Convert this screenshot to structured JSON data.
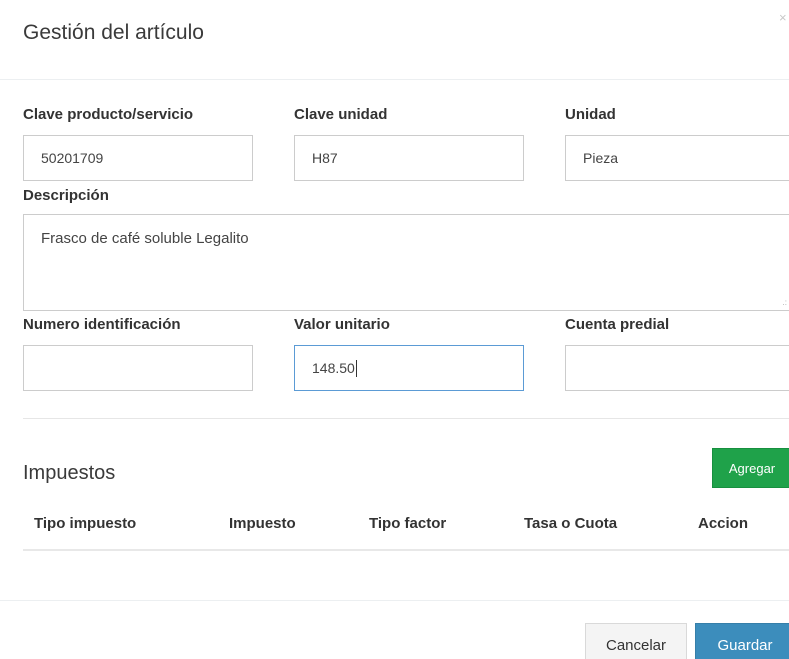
{
  "modal": {
    "title": "Gestión del artículo",
    "close_label": "×"
  },
  "form": {
    "clave_producto": {
      "label": "Clave producto/servicio",
      "value": "50201709"
    },
    "clave_unidad": {
      "label": "Clave unidad",
      "value": "H87"
    },
    "unidad": {
      "label": "Unidad",
      "value": "Pieza"
    },
    "descripcion": {
      "label": "Descripción",
      "value": "Frasco de café soluble Legalito"
    },
    "numero_identificacion": {
      "label": "Numero identificación",
      "value": ""
    },
    "valor_unitario": {
      "label": "Valor unitario",
      "value": "148.50"
    },
    "cuenta_predial": {
      "label": "Cuenta predial",
      "value": ""
    }
  },
  "impuestos": {
    "title": "Impuestos",
    "add_label": "Agregar",
    "columns": [
      "Tipo impuesto",
      "Impuesto",
      "Tipo factor",
      "Tasa o Cuota",
      "Accion"
    ],
    "rows": []
  },
  "footer": {
    "cancel_label": "Cancelar",
    "save_label": "Guardar"
  },
  "colors": {
    "add_button": "#1fa24a",
    "save_button": "#3c8dbc",
    "focus_border": "#5b9bd5"
  }
}
